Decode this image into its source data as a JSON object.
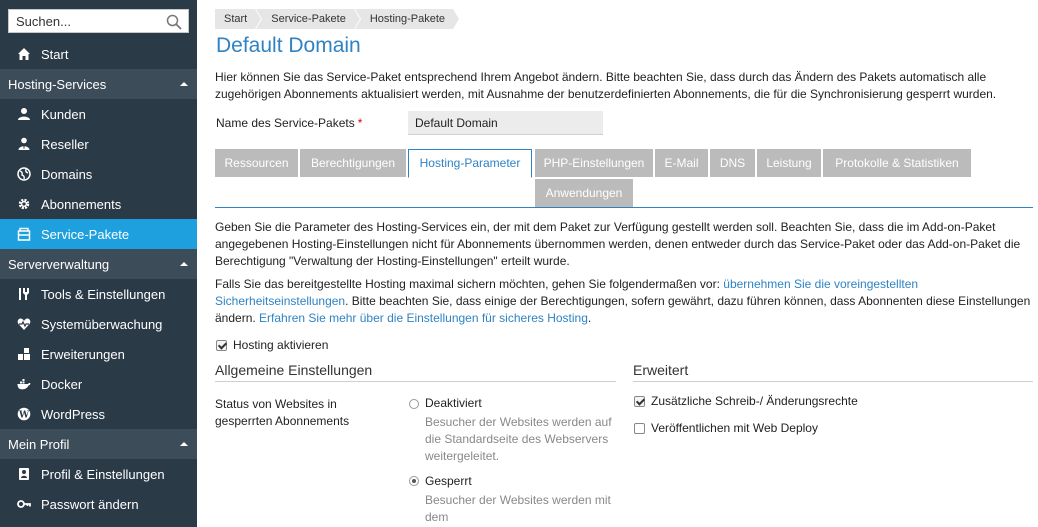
{
  "search": {
    "placeholder": "Suchen..."
  },
  "sidebar": {
    "start": "Start",
    "hosting_services": {
      "title": "Hosting-Services",
      "items": [
        "Kunden",
        "Reseller",
        "Domains",
        "Abonnements",
        "Service-Pakete"
      ]
    },
    "serververwaltung": {
      "title": "Serververwaltung",
      "items": [
        "Tools & Einstellungen",
        "Systemüberwachung",
        "Erweiterungen",
        "Docker",
        "WordPress"
      ]
    },
    "mein_profil": {
      "title": "Mein Profil",
      "items": [
        "Profil & Einstellungen",
        "Passwort ändern"
      ]
    },
    "active_item": "Service-Pakete"
  },
  "breadcrumb": [
    "Start",
    "Service-Pakete",
    "Hosting-Pakete"
  ],
  "page": {
    "title": "Default Domain",
    "intro": "Hier können Sie das Service-Paket entsprechend Ihrem Angebot ändern. Bitte beachten Sie, dass durch das Ändern des Pakets automatisch alle zugehörigen Abonnements aktualisiert werden, mit Ausnahme der benutzerdefinierten Abonnements, die für die Synchronisierung gesperrt wurden.",
    "name_label": "Name des Service-Pakets",
    "name_required": "*",
    "name_value": "Default Domain"
  },
  "tabs": {
    "items": [
      "Ressourcen",
      "Berechtigungen",
      "Hosting-Parameter",
      "PHP-Einstellungen",
      "E-Mail",
      "DNS",
      "Leistung",
      "Protokolle & Statistiken",
      "Anwendungen"
    ],
    "active": "Hosting-Parameter"
  },
  "content": {
    "para1": "Geben Sie die Parameter des Hosting-Services ein, der mit dem Paket zur Verfügung gestellt werden soll. Beachten Sie, dass die im Add-on-Paket angegebenen Hosting-Einstellungen nicht für Abonnements übernommen werden, denen entweder durch das Service-Paket oder das Add-on-Paket die Berechtigung \"Verwaltung der Hosting-Einstellungen\" erteilt wurde.",
    "para2_a": "Falls Sie das bereitgestellte Hosting maximal sichern möchten, gehen Sie folgendermaßen vor: ",
    "para2_link1": "übernehmen Sie die voreingestellten Sicherheitseinstellungen",
    "para2_b": ". Bitte beachten Sie, dass einige der Berechtigungen, sofern gewährt, dazu führen können, dass Abonnenten diese Einstellungen ändern. ",
    "para2_link2": "Erfahren Sie mehr über die Einstellungen für sicheres Hosting",
    "para2_c": ".",
    "hosting_activate": "Hosting aktivieren",
    "general_title": "Allgemeine Einstellungen",
    "advanced_title": "Erweitert",
    "status_label": "Status von Websites in gesperrten Abonnements",
    "opt_deactivated": "Deaktiviert",
    "opt_deactivated_desc": "Besucher der Websites werden auf die Standardseite des Webservers weitergeleitet.",
    "opt_locked": "Gesperrt",
    "opt_locked_desc": "Besucher der Websites werden mit dem",
    "adv_write": "Zusätzliche Schreib-/ Änderungsrechte",
    "adv_webdeploy": "Veröffentlichen mit Web Deploy"
  }
}
